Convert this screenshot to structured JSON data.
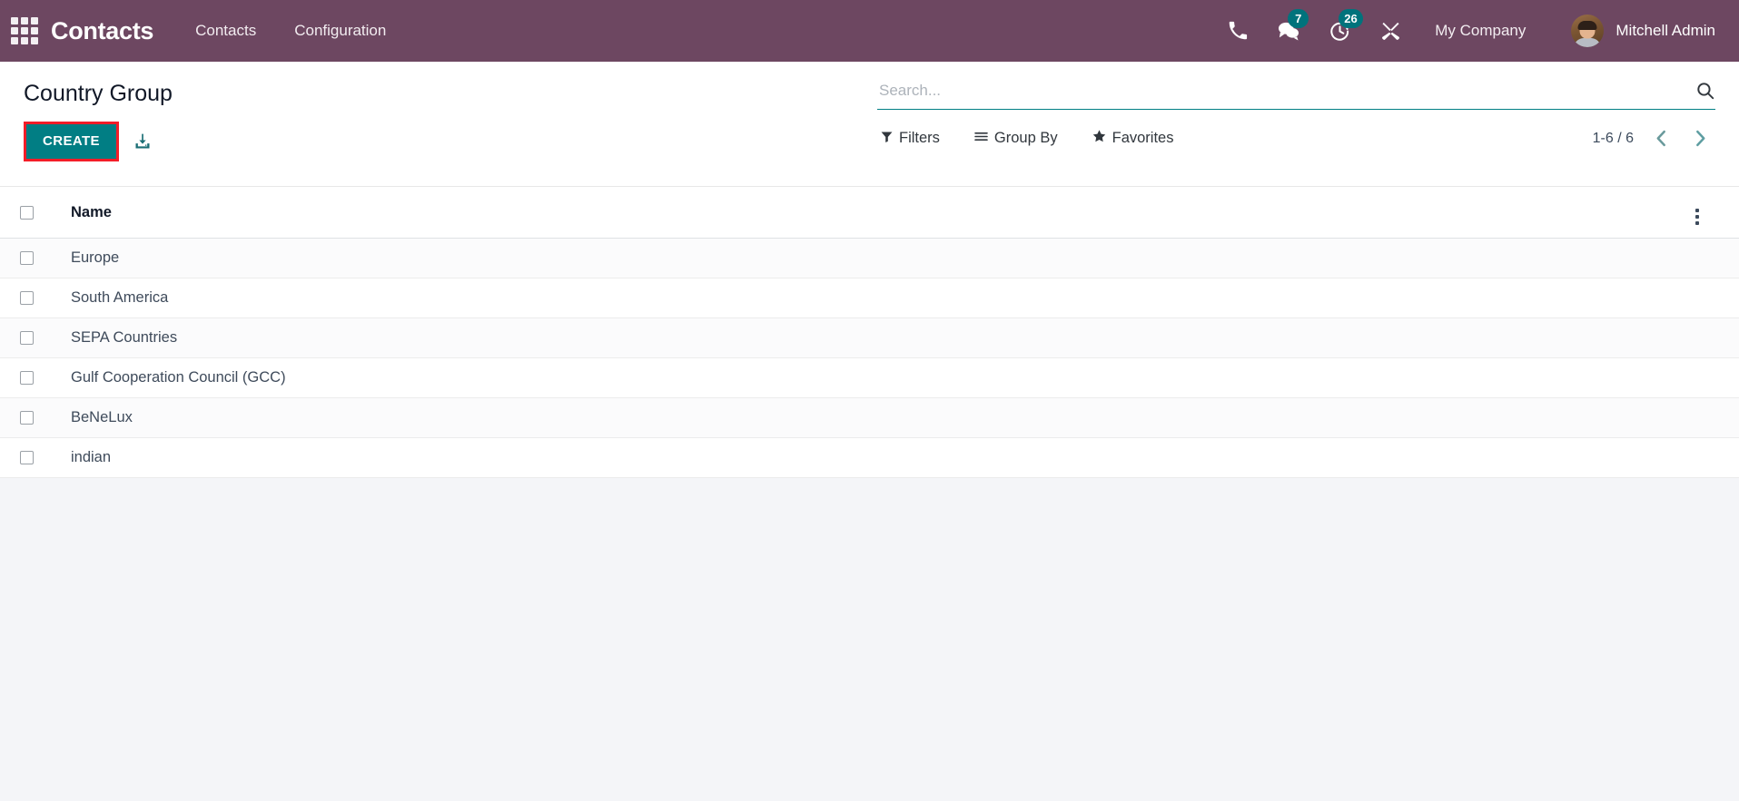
{
  "navbar": {
    "apps_icon": "apps-grid-icon",
    "brand": "Contacts",
    "menu": [
      {
        "label": "Contacts",
        "name": "navbar-menu-contacts"
      },
      {
        "label": "Configuration",
        "name": "navbar-menu-configuration"
      }
    ],
    "systray": [
      {
        "name": "phone-icon",
        "icon": "phone",
        "badge": null
      },
      {
        "name": "messages-icon",
        "icon": "comments",
        "badge": "7"
      },
      {
        "name": "activities-icon",
        "icon": "clock",
        "badge": "26"
      },
      {
        "name": "tools-icon",
        "icon": "wrench-screwdriver",
        "badge": null
      }
    ],
    "company": "My Company",
    "username": "Mitchell Admin",
    "avatar_alt": "Mitchell Admin avatar",
    "bg_color": "#6d4761",
    "badge_color": "#00737c"
  },
  "control_panel": {
    "title": "Country Group",
    "create_label": "CREATE",
    "create_color": "#017e84",
    "highlight_color": "#f41d28",
    "import_icon": "import-download-icon",
    "search": {
      "placeholder": "Search...",
      "value": "",
      "icon": "search-icon"
    },
    "facets": [
      {
        "label": "Filters",
        "icon": "filter-funnel-icon",
        "name": "filters-button"
      },
      {
        "label": "Group By",
        "icon": "hamburger-lines-icon",
        "name": "group-by-button"
      },
      {
        "label": "Favorites",
        "icon": "star-icon",
        "name": "favorites-button"
      }
    ],
    "pager": {
      "range": "1-6 / 6",
      "previous_icon": "chevron-left-icon",
      "next_icon": "chevron-right-icon",
      "arrow_color": "#6a9a9c"
    }
  },
  "list_view": {
    "columns": [
      {
        "key": "select_all",
        "label": "",
        "type": "checkbox"
      },
      {
        "key": "name",
        "label": "Name",
        "type": "text"
      },
      {
        "key": "options",
        "label": "",
        "type": "menu"
      }
    ],
    "options_icon": "vertical-dots-icon",
    "rows": [
      {
        "name": "Europe"
      },
      {
        "name": "South America"
      },
      {
        "name": "SEPA Countries"
      },
      {
        "name": "Gulf Cooperation Council (GCC)"
      },
      {
        "name": "BeNeLux"
      },
      {
        "name": "indian"
      }
    ]
  }
}
